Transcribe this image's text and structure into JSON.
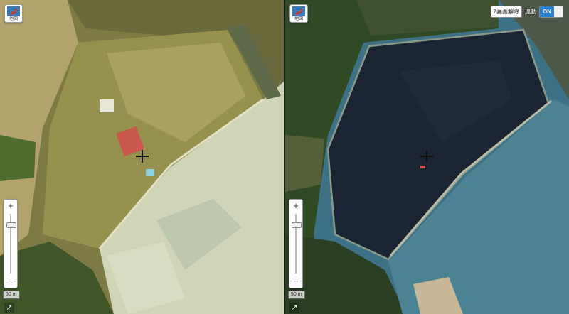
{
  "logo": {
    "label": "地図"
  },
  "zoom": {
    "plus": "+",
    "minus": "−",
    "level": 0.85
  },
  "scale": {
    "label": "50 m"
  },
  "corner": {
    "symbol": "↗"
  },
  "sync": {
    "release_label": "2画面解除",
    "label": "連動",
    "state": "ON"
  },
  "colors": {
    "old_sea": "#cfd5b6",
    "old_land": "#8f8a4e",
    "new_reservoir": "#1a2433",
    "new_sea": "#3d7286",
    "new_forest": "#2f4a25",
    "toggle_on": "#2a7fd0"
  }
}
